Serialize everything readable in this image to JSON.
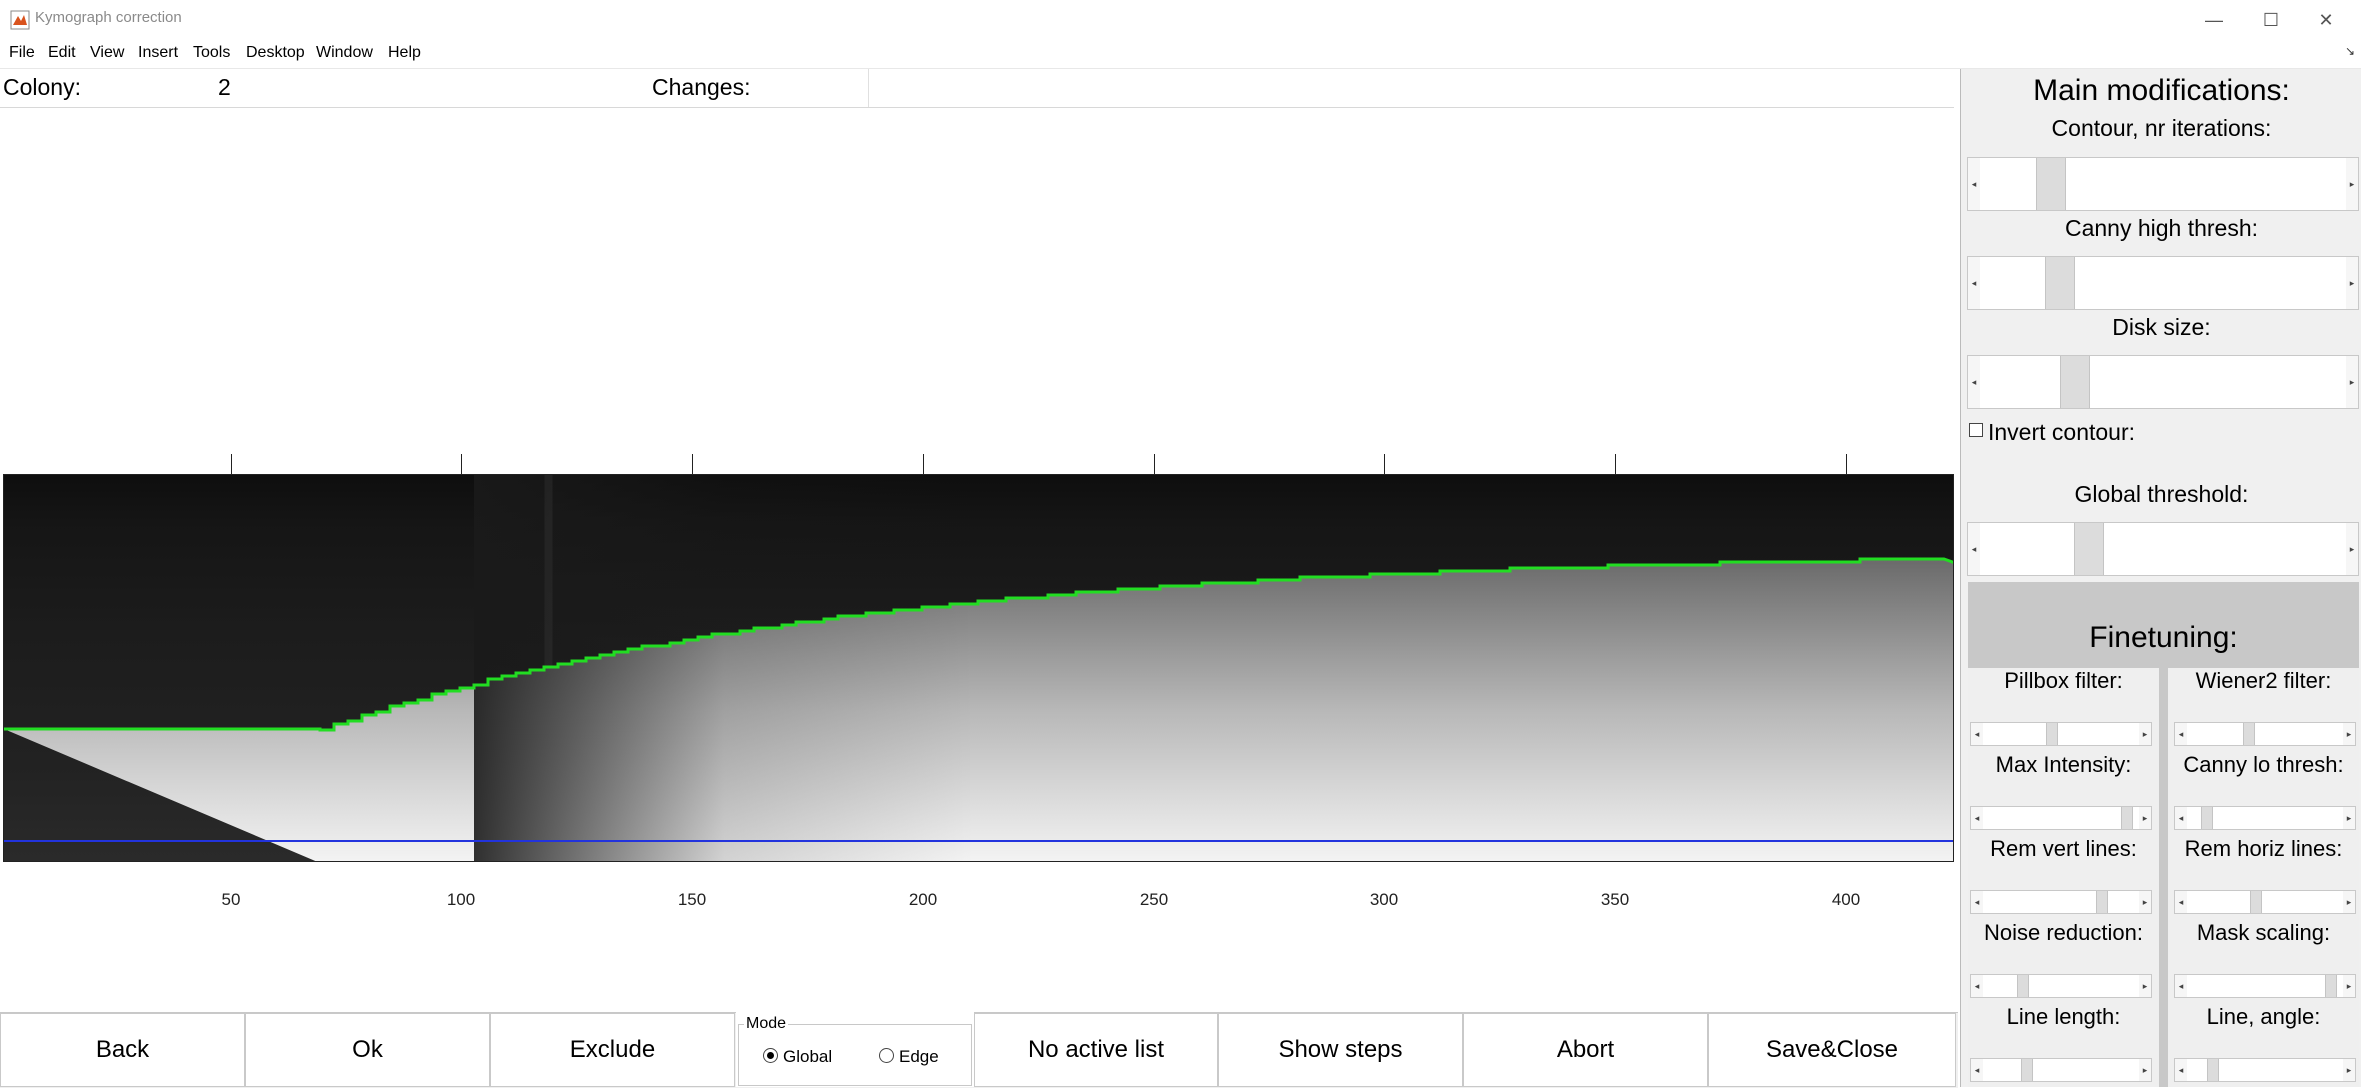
{
  "window": {
    "title": "Kymograph correction",
    "minimize": "—",
    "maximize": "☐",
    "close": "✕",
    "dock": "↘"
  },
  "menu": [
    "File",
    "Edit",
    "View",
    "Insert",
    "Tools",
    "Desktop",
    "Window",
    "Help"
  ],
  "colony": {
    "label": "Colony:",
    "value": "2",
    "changes_label": "Changes:"
  },
  "axis": {
    "x_ticks": [
      "50",
      "100",
      "150",
      "200",
      "250",
      "300",
      "350",
      "400"
    ]
  },
  "main_modifications": {
    "title": "Main modifications:",
    "contour_label": "Contour, nr iterations:",
    "canny_high_label": "Canny high thresh:",
    "disk_size_label": "Disk size:",
    "invert_label": "Invert contour:",
    "invert_checked": false,
    "global_threshold_label": "Global threshold:"
  },
  "finetuning": {
    "title": "Finetuning:",
    "pillbox": "Pillbox filter:",
    "wiener": "Wiener2 filter:",
    "max_intensity": "Max Intensity:",
    "canny_lo": "Canny lo thresh:",
    "rem_vert": "Rem vert lines:",
    "rem_horiz": "Rem horiz lines:",
    "noise": "Noise reduction:",
    "mask_scaling": "Mask scaling:",
    "line_length": "Line length:",
    "line_angle": "Line, angle:"
  },
  "buttons": {
    "back": "Back",
    "ok": "Ok",
    "exclude": "Exclude",
    "no_active_list": "No active list",
    "show_steps": "Show steps",
    "abort": "Abort",
    "save_close": "Save&Close"
  },
  "mode": {
    "legend": "Mode",
    "global": "Global",
    "edge": "Edge",
    "selected": "Global"
  },
  "colors": {
    "contour": "#22dd22",
    "baseline": "#2233dd"
  }
}
